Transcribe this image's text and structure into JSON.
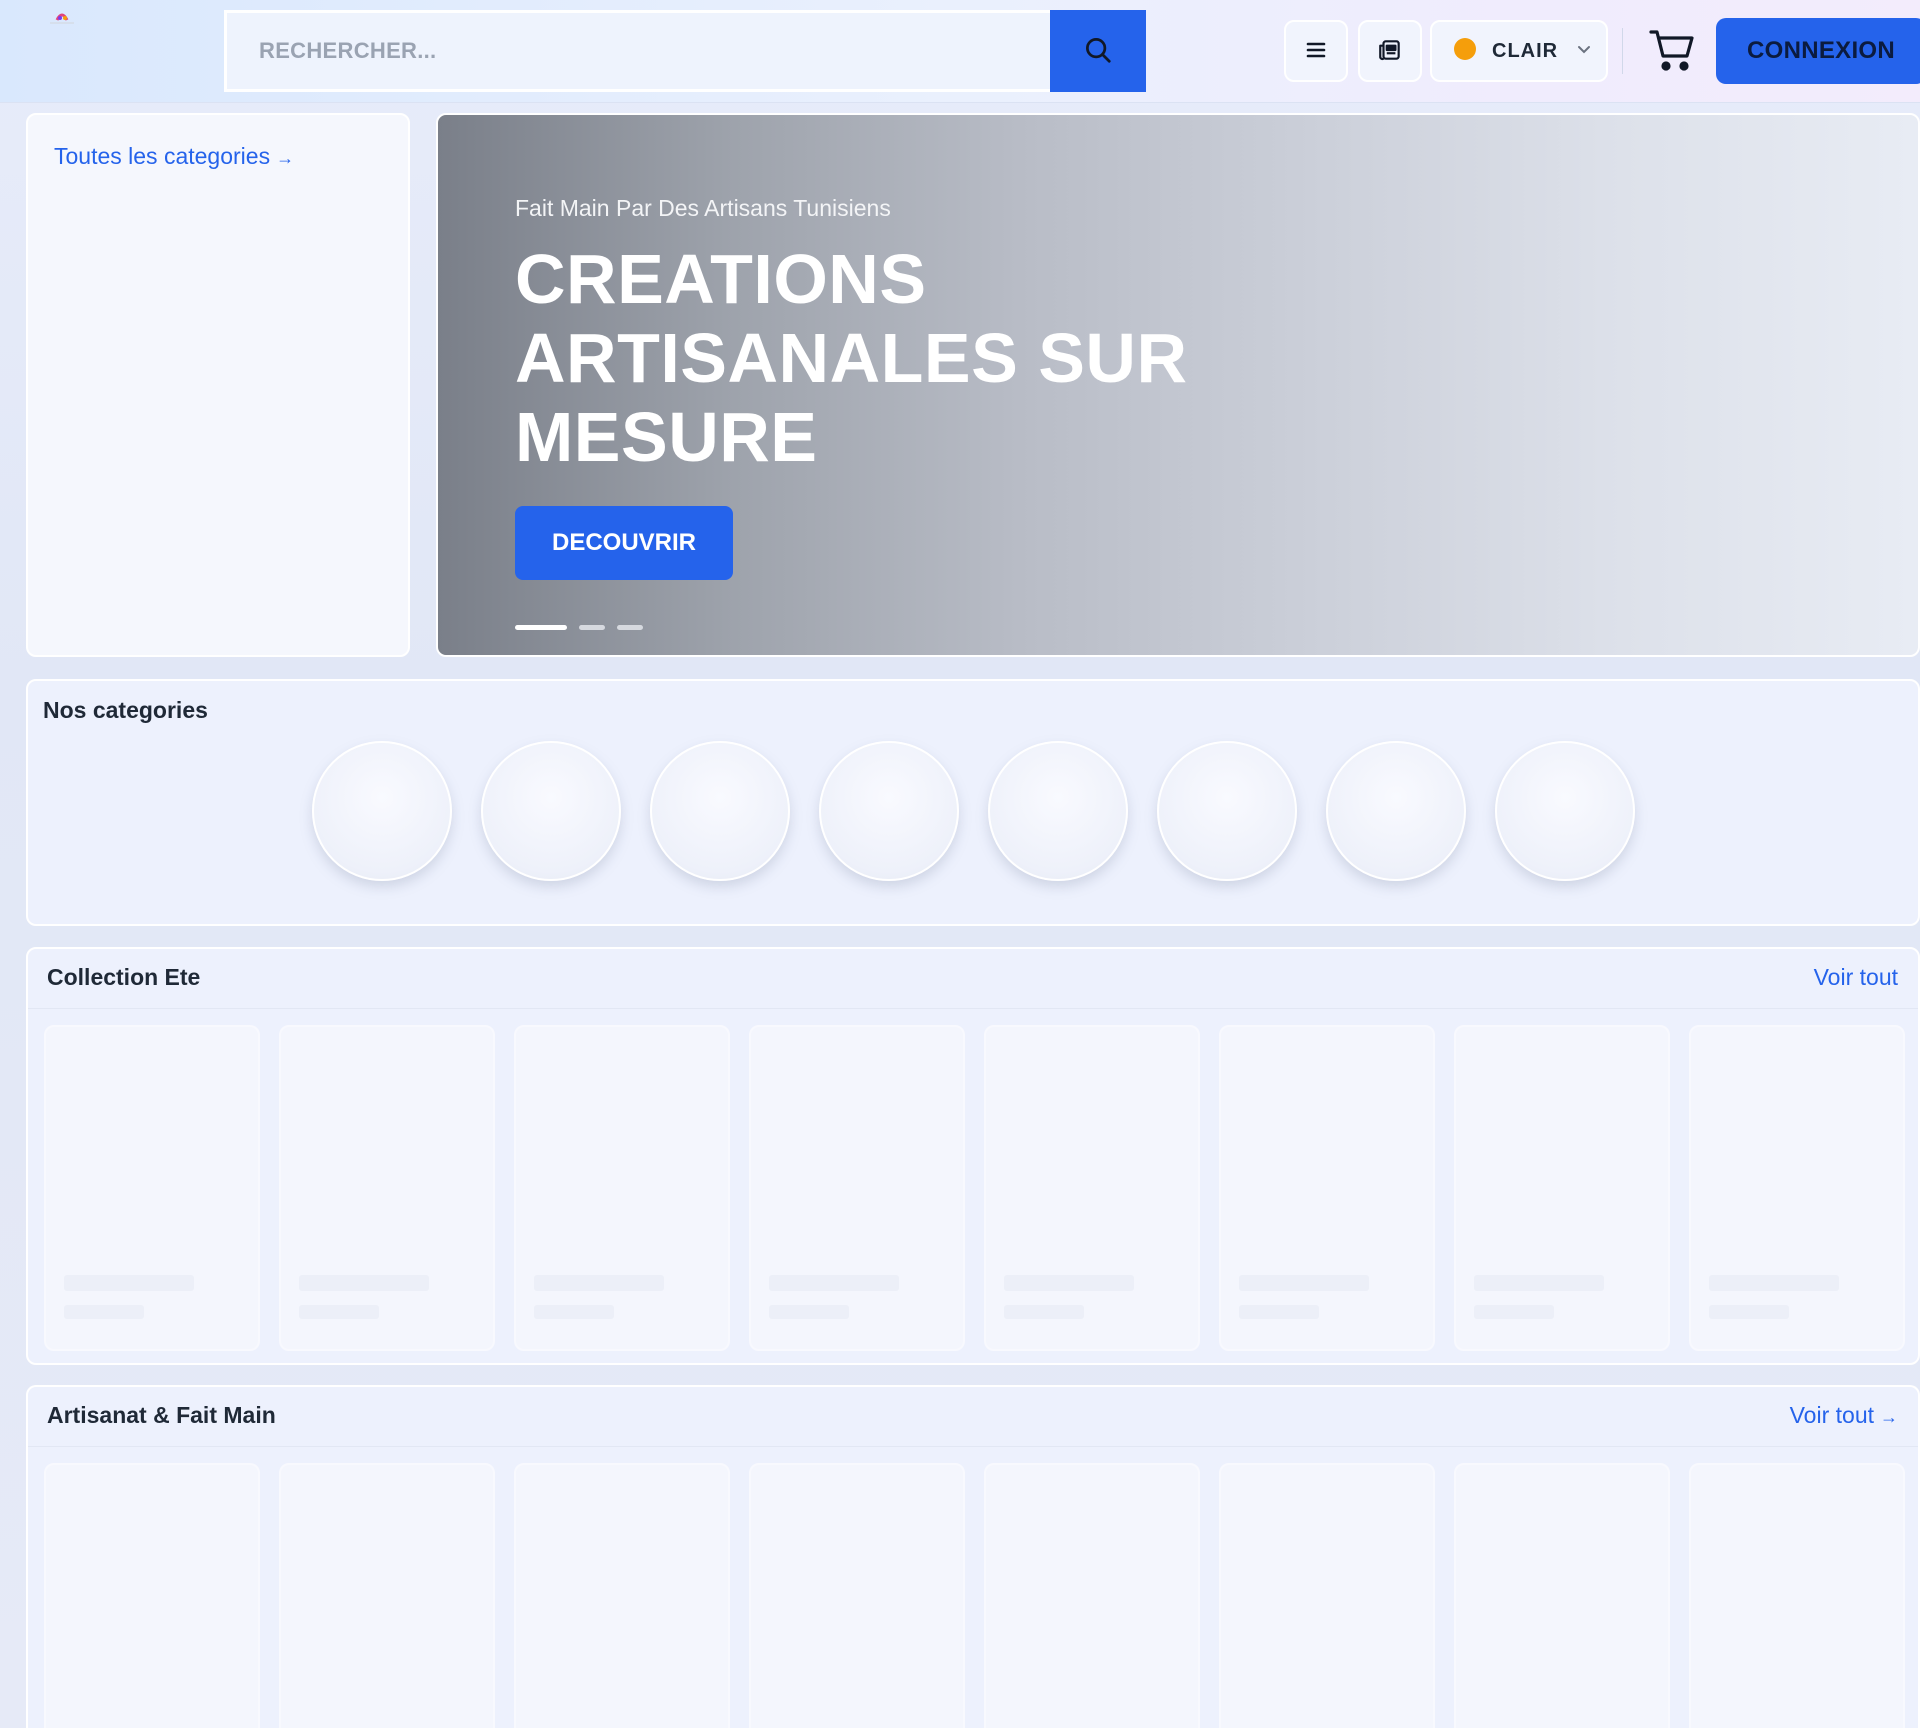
{
  "header": {
    "search_placeholder": "RECHERCHER...",
    "theme_label": "CLAIR",
    "login_label": "CONNEXION",
    "icons": [
      "logo-icon",
      "search-icon",
      "menu-icon",
      "news-icon",
      "theme-icon",
      "chevron-down-icon",
      "cart-icon"
    ]
  },
  "sidebar": {
    "all_categories_label": "Toutes les categories",
    "all_categories_arrow": "→"
  },
  "hero": {
    "subtitle": "Fait Main Par Des Artisans Tunisiens",
    "title_lines": [
      "CREATIONS",
      "ARTISANALES SUR",
      "MESURE"
    ],
    "cta_label": "DECOUVRIR",
    "slide_count": 3,
    "active_slide": 1
  },
  "categories": {
    "title": "Nos categories",
    "item_count": 8
  },
  "sections": [
    {
      "title": "Collection Ete",
      "see_all_label": "Voir tout",
      "see_all_arrow": "",
      "card_count": 8
    },
    {
      "title": "Artisanat & Fait Main",
      "see_all_label": "Voir tout",
      "see_all_arrow": "→",
      "card_count": 8
    }
  ],
  "colors": {
    "accent": "#2563eb",
    "link": "#2563eb",
    "text_dark": "#1f2937",
    "placeholder": "#9aa3b2"
  }
}
